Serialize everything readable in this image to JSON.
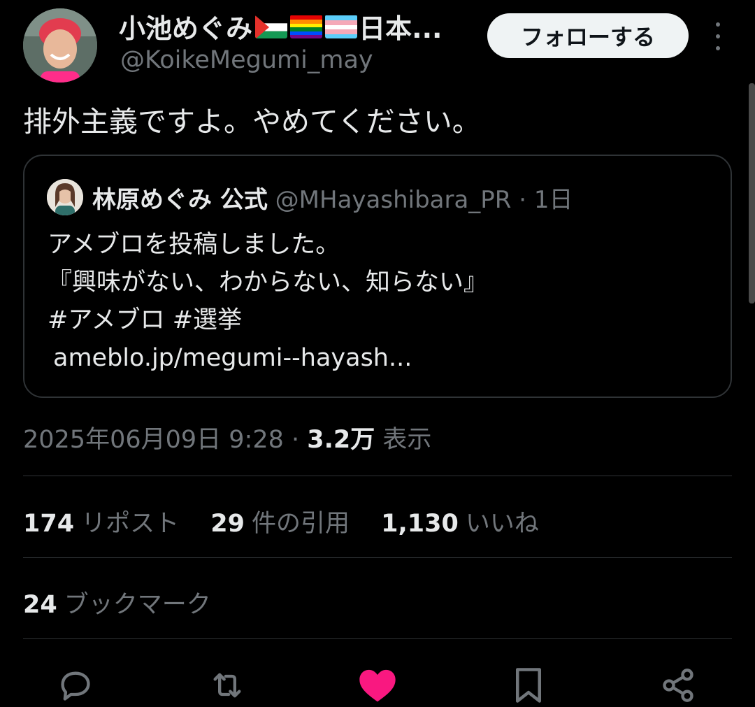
{
  "author": {
    "display_name": "小池めぐみ",
    "name_suffix": "日本...",
    "handle": "@KoikeMegumi_may",
    "flags": [
      "palestine-flag",
      "rainbow-flag",
      "transgender-flag"
    ]
  },
  "follow_label": "フォローする",
  "tweet_text": "排外主義ですよ。やめてください。",
  "quote": {
    "name": "林原めぐみ 公式",
    "handle": "@MHayashibara_PR",
    "separator": " · ",
    "age": "1日",
    "lines": [
      "アメブロを投稿しました。",
      "『興味がない、わからない、知らない』",
      "#アメブロ  #選挙"
    ],
    "link": "ameblo.jp/megumi--hayash..."
  },
  "meta": {
    "datetime": "2025年06月09日 9:28",
    "separator": " · ",
    "views_count": "3.2万",
    "views_label": "表示"
  },
  "stats": {
    "reposts_count": "174",
    "reposts_label": "リポスト",
    "quotes_count": "29",
    "quotes_label": "件の引用",
    "likes_count": "1,130",
    "likes_label": "いいね"
  },
  "bookmarks": {
    "count": "24",
    "label": "ブックマーク"
  },
  "actions": [
    "reply-icon",
    "repost-icon",
    "like-icon",
    "bookmark-icon",
    "share-icon"
  ],
  "colors": {
    "background": "#000000",
    "text": "#e7e9ea",
    "muted": "#71767b",
    "border": "#2f3336",
    "like": "#f91880"
  }
}
